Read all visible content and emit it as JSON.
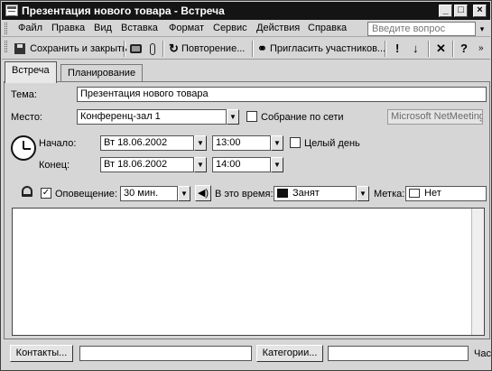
{
  "window": {
    "title": "Презентация нового товара - Встреча",
    "min_glyph": "_",
    "max_glyph": "□",
    "close_glyph": "×"
  },
  "menu": {
    "items": [
      "Файл",
      "Правка",
      "Вид",
      "Вставка",
      "Формат",
      "Сервис",
      "Действия",
      "Справка"
    ],
    "help_placeholder": "Введите вопрос",
    "help_dropdown_glyph": "▾"
  },
  "toolbar": {
    "save_close": "Сохранить и закрыть",
    "recurrence": "Повторение...",
    "invite": "Пригласить участников...",
    "priority_high_glyph": "!",
    "priority_low_glyph": "↓",
    "delete_glyph": "✕",
    "help_glyph": "?",
    "recurrence_glyph": "↻",
    "invite_glyph": "⚭",
    "more_glyph": "»"
  },
  "tabs": [
    {
      "label": "Встреча",
      "active": true
    },
    {
      "label": "Планирование",
      "active": false
    }
  ],
  "form": {
    "subject_label": "Тема:",
    "subject_value": "Презентация нового товара",
    "location_label": "Место:",
    "location_value": "Конференц-зал 1",
    "online_meeting_label": "Собрание по сети",
    "online_meeting_checked": false,
    "netmeeting_value": "Microsoft NetMeeting",
    "start_label": "Начало:",
    "start_date": "Вт 18.06.2002",
    "start_time": "13:00",
    "all_day_label": "Целый день",
    "all_day_checked": false,
    "end_label": "Конец:",
    "end_date": "Вт 18.06.2002",
    "end_time": "14:00",
    "reminder_label": "Оповещение:",
    "reminder_checked": true,
    "reminder_value": "30 мин.",
    "show_as_label": "В это время:",
    "show_as_value": "Занят",
    "label_label": "Метка:",
    "label_value": "Нет",
    "dropdown_glyph": "▼",
    "check_glyph": "✓",
    "sound_glyph": "◀)"
  },
  "footer": {
    "contacts_button": "Контакты...",
    "contacts_value": "",
    "categories_button": "Категории...",
    "categories_value": "",
    "private_label": "Час"
  }
}
